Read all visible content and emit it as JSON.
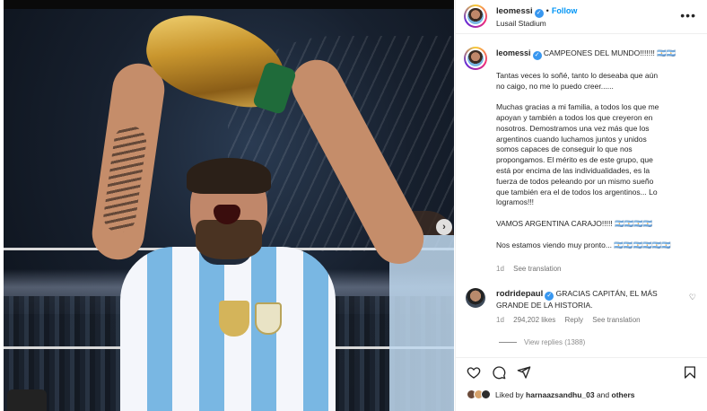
{
  "header": {
    "username": "leomessi",
    "follow_label": "Follow",
    "dot": "•",
    "location": "Lusail Stadium",
    "more_label": "•••"
  },
  "caption": {
    "username": "leomessi",
    "title": "CAMPEONES DEL MUNDO!!!!!!! 🇦🇷🇦🇷",
    "paragraphs": [
      "Tantas veces lo soñé, tanto lo deseaba que aún\nno caigo, no me lo puedo creer......",
      "Muchas gracias a mi familia, a todos los que me\napoyan y también a todos los que creyeron en\nnosotros. Demostramos una vez más que los\nargentinos cuando luchamos juntos y unidos\nsomos capaces de conseguir lo que nos\npropongamos. El mérito es de este grupo, que\nestá por encima de las individualidades, es la\nfuerza de todos peleando por un mismo sueño\nque también era el de todos los argentinos... Lo\nlogramos!!!",
      "VAMOS ARGENTINA CARAJO!!!!! 🇦🇷🇦🇷🇦🇷🇦🇷",
      "Nos estamos viendo muy pronto... 🇦🇷🇦🇷🇦🇷🇦🇷🇦🇷🇦🇷"
    ],
    "age": "1d",
    "see_translation": "See translation"
  },
  "reply": {
    "username": "rodridepaul",
    "text": "GRACIAS CAPITÁN, EL MÁS GRANDE DE LA HISTORIA.",
    "age": "1d",
    "likes": "294,202 likes",
    "reply_label": "Reply",
    "see_translation": "See translation",
    "view_replies": "View replies (1388)"
  },
  "likes": {
    "prefix": "Liked by",
    "user": "harnaazsandhu_03",
    "middle": "and",
    "suffix": "others"
  },
  "colors": {
    "accent": "#0095f6",
    "verified": "#3897f0",
    "muted": "#8e8e8e"
  },
  "icons": {
    "like": "heart-icon",
    "comment": "comment-icon",
    "share": "share-icon",
    "save": "bookmark-icon",
    "next": "chevron-right-icon",
    "more": "more-icon"
  }
}
